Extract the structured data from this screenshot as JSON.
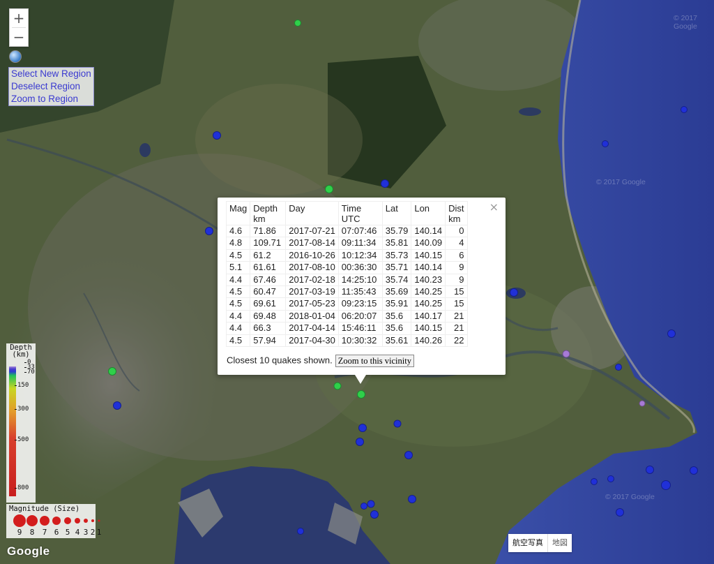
{
  "map": {
    "zoom_in": "+",
    "zoom_out": "−",
    "region_menu": [
      "Select New Region",
      "Deselect Region",
      "Zoom to Region"
    ],
    "watermark": "© 2017 Google",
    "google_logo": "Google",
    "map_types": [
      "航空写真",
      "地図"
    ],
    "globe_icon": "globe-icon"
  },
  "popup": {
    "close": "×",
    "headers": [
      "Mag",
      "Depth km",
      "Day",
      "Time UTC",
      "Lat",
      "Lon",
      "Dist km"
    ],
    "rows": [
      [
        "4.6",
        "71.86",
        "2017-07-21",
        "07:07:46",
        "35.79",
        "140.14",
        "0"
      ],
      [
        "4.8",
        "109.71",
        "2017-08-14",
        "09:11:34",
        "35.81",
        "140.09",
        "4"
      ],
      [
        "4.5",
        "61.2",
        "2016-10-26",
        "10:12:34",
        "35.73",
        "140.15",
        "6"
      ],
      [
        "5.1",
        "61.61",
        "2017-08-10",
        "00:36:30",
        "35.71",
        "140.14",
        "9"
      ],
      [
        "4.4",
        "67.46",
        "2017-02-18",
        "14:25:10",
        "35.74",
        "140.23",
        "9"
      ],
      [
        "4.5",
        "60.47",
        "2017-03-19",
        "11:35:43",
        "35.69",
        "140.25",
        "15"
      ],
      [
        "4.5",
        "69.61",
        "2017-05-23",
        "09:23:15",
        "35.91",
        "140.25",
        "15"
      ],
      [
        "4.4",
        "69.48",
        "2018-01-04",
        "06:20:07",
        "35.6",
        "140.17",
        "21"
      ],
      [
        "4.4",
        "66.3",
        "2017-04-14",
        "15:46:11",
        "35.6",
        "140.15",
        "21"
      ],
      [
        "4.5",
        "57.94",
        "2017-04-30",
        "10:30:32",
        "35.61",
        "140.26",
        "22"
      ]
    ],
    "footer": "Closest 10 quakes shown.",
    "zoom_button": "Zoom to this vicinity"
  },
  "depth_legend": {
    "title": "Depth (km)",
    "ticks": [
      "0",
      "33",
      "70",
      "150",
      "300",
      "500",
      "800"
    ]
  },
  "magnitude_legend": {
    "title": "Magnitude (Size)",
    "labels": [
      "9",
      "8",
      "7",
      "6",
      "5",
      "4",
      "3",
      "2",
      "1"
    ]
  },
  "colors": {
    "shallow_purple": "#a77ad6",
    "mid_blue": "#2030d8",
    "deep_green": "#2fd04a",
    "magnitude_red": "#d31d1d"
  }
}
